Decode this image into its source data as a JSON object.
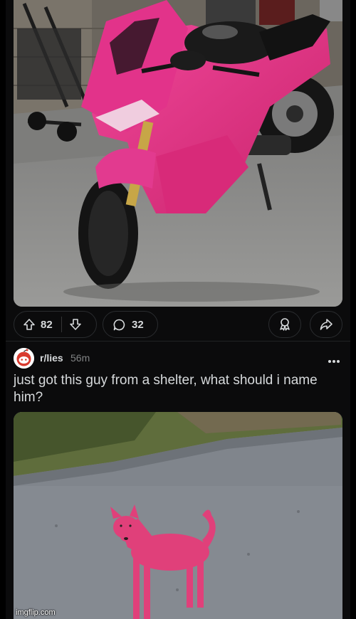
{
  "post1": {
    "image_alt": "pink motorcycle",
    "upvotes": "82",
    "comments": "32",
    "icons": [
      "upvote-icon",
      "downvote-icon",
      "comment-icon",
      "award-icon",
      "share-icon"
    ]
  },
  "post2": {
    "subreddit": "r/lies",
    "time": "56m",
    "title": "just got this guy from a shelter, what should i name him?",
    "image_alt": "pink dog standing on a road",
    "icons": [
      "subreddit-avatar-icon",
      "more-options-icon"
    ]
  },
  "watermark": "imgflip.com",
  "colors": {
    "background": "#0b0b0c",
    "text": "#d7dadc",
    "muted": "#818384",
    "pill_border": "#2a2c2f",
    "pink": "#e6337f"
  }
}
